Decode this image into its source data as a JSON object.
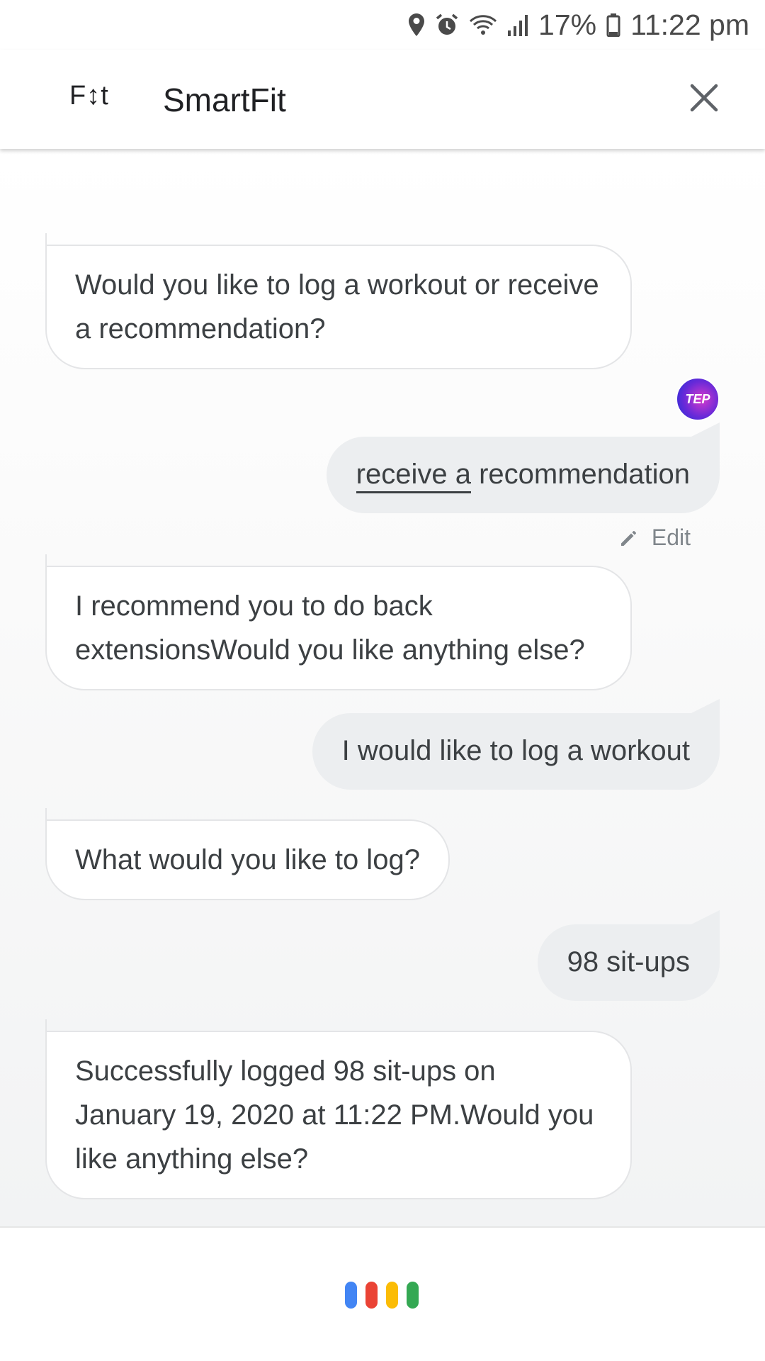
{
  "status_bar": {
    "battery": "17%",
    "time": "11:22 pm",
    "icons": [
      "location-icon",
      "alarm-icon",
      "wifi-icon",
      "signal-icon",
      "battery-icon"
    ]
  },
  "header": {
    "logo": "F↕t",
    "title": "SmartFit",
    "close_icon": "close-icon"
  },
  "messages": {
    "m1": "Would you like to log a workout or receive a recommendation?",
    "m2_underlined": "receive a",
    "m2_rest": " recommendation",
    "m3": "I recommend you to do back extensionsWould you like anything else?",
    "m4": "I would like to log a workout",
    "m5": "What would you like to log?",
    "m6": "98 sit-ups",
    "m7": "Successfully logged 98 sit-ups on January 19, 2020 at 11:22 PM.Would you like anything else?"
  },
  "avatar": {
    "initials": "TEP"
  },
  "edit": {
    "label": "Edit",
    "icon": "pencil-icon"
  },
  "assistant": {
    "icon": "google-assistant-dots-icon",
    "colors": [
      "#4285f4",
      "#ea4335",
      "#fbbc05",
      "#34a853"
    ]
  }
}
